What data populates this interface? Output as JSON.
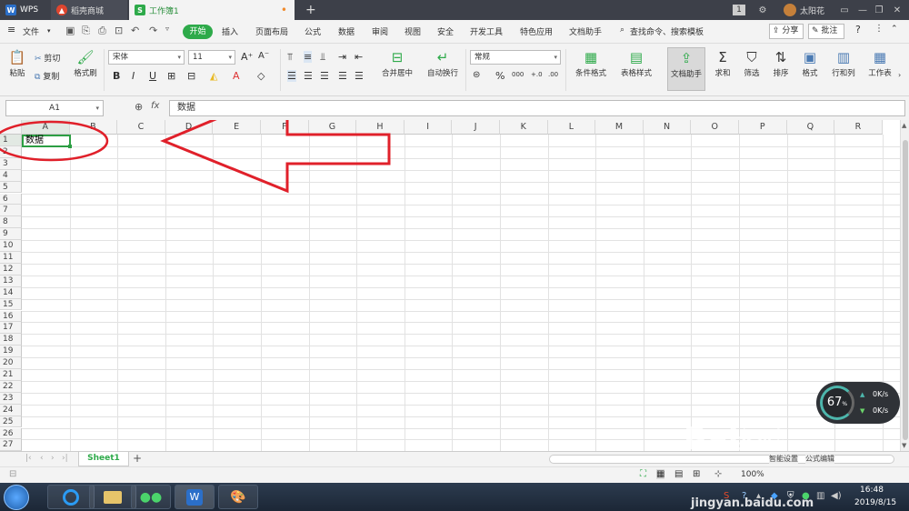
{
  "tabs": [
    {
      "label": "WPS",
      "icon": "wps-logo-icon",
      "color": "#2b6fc9"
    },
    {
      "label": "稻壳商城",
      "icon": "docer-flame-icon",
      "color": "#e0452e"
    },
    {
      "label": "工作簿1",
      "icon": "spreadsheet-doc-icon",
      "color": "#2eaa4a",
      "modified_dot": "•"
    }
  ],
  "new_tab": "+",
  "window_badge": "1",
  "user_name": "太阳花",
  "menu": {
    "file": "文件",
    "items": [
      "开始",
      "插入",
      "页面布局",
      "公式",
      "数据",
      "审阅",
      "视图",
      "安全",
      "开发工具",
      "特色应用",
      "文档助手"
    ],
    "active": "开始",
    "search": "查找命令、搜索模板",
    "share": "分享",
    "comment": "批注",
    "help": "?"
  },
  "ribbon": {
    "paste": "粘贴",
    "cut": "剪切",
    "copy": "复制",
    "format_painter": "格式刷",
    "font_name": "宋体",
    "font_size": "11",
    "bold": "B",
    "italic": "I",
    "underline": "U",
    "merge_center": "合并居中",
    "wrap_text": "自动换行",
    "number_format": "常规",
    "percent": "%",
    "thousands": "000",
    "inc_decimal": "+.0",
    "dec_decimal": ".00",
    "conditional_format": "条件格式",
    "table_style": "表格样式",
    "doc_helper": "文档助手",
    "sum": "求和",
    "filter": "筛选",
    "sort": "排序",
    "format": "格式",
    "row_col": "行和列",
    "worksheet": "工作表"
  },
  "formula_bar": {
    "name_box": "A1",
    "fx": "fx",
    "content": "数据"
  },
  "grid": {
    "columns": [
      "A",
      "B",
      "C",
      "D",
      "E",
      "F",
      "G",
      "H",
      "I",
      "J",
      "K",
      "L",
      "M",
      "N",
      "O",
      "P",
      "Q",
      "R"
    ],
    "rows": [
      "1",
      "2",
      "3",
      "4",
      "5",
      "6",
      "7",
      "8",
      "9",
      "10",
      "11",
      "12",
      "13",
      "14",
      "15",
      "16",
      "17",
      "18",
      "19",
      "20",
      "21",
      "22",
      "23",
      "24",
      "25",
      "26",
      "27"
    ],
    "cell_a1": "数据",
    "selection_color": "#2c9e43",
    "annotation_color": "#e0202a"
  },
  "sheet_tabs": {
    "active": "Sheet1",
    "add": "+"
  },
  "status": {
    "zoom": "100%",
    "buttons": [
      "智能设置",
      "公式编辑"
    ]
  },
  "net_widget": {
    "percent": "67",
    "unit": "%",
    "up": "0K/s",
    "down": "0K/s"
  },
  "watermark": {
    "main": "Bai",
    "sub": "经验",
    "url": "jingyan.baidu.com"
  },
  "taskbar": {
    "time": "16:48",
    "date": "2019/8/15",
    "apps": [
      "start-orb",
      "browser",
      "file-explorer",
      "wechat",
      "wps",
      "paint"
    ]
  }
}
